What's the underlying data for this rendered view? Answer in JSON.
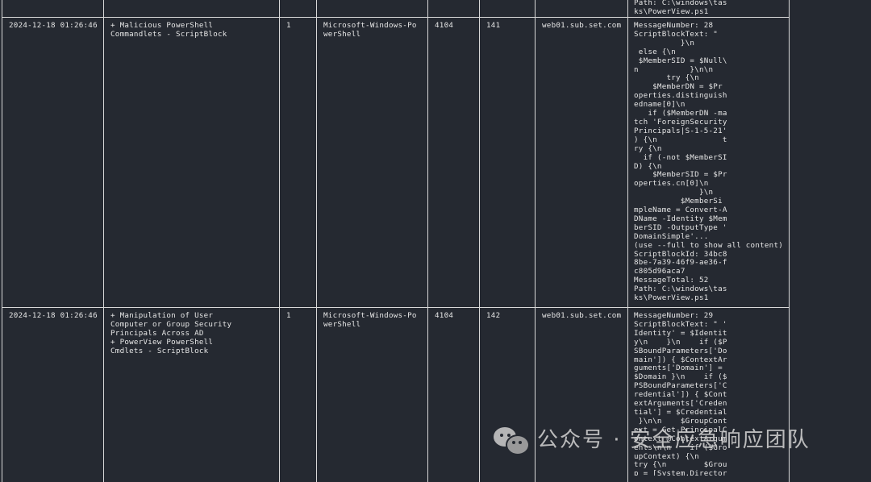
{
  "rows": [
    {
      "time": "",
      "rule": "",
      "level": "",
      "channel": "",
      "event_id": "",
      "record_id": "",
      "computer": "",
      "details": "Path: C:\\windows\\tas\nks\\PowerView.ps1"
    },
    {
      "time": "2024-12-18 01:26:46",
      "rule": "+ Malicious PowerShell\nCommandlets - ScriptBlock",
      "level": "1",
      "channel": "Microsoft-Windows-Po\nwerShell",
      "event_id": "4104",
      "record_id": "141",
      "computer": "web01.sub.set.com",
      "details": "MessageNumber: 28\nScriptBlockText: \"\n          }\\n\n else {\\n\n $MemberSID = $Null\\\nn           }\\n\\n\n       try {\\n\n    $MemberDN = $Pr\noperties.distinguish\nedname[0]\\n\n   if ($MemberDN -ma\ntch 'ForeignSecurity\nPrincipals|S-1-5-21'\n) {\\n              t\nry {\\n\n  if (-not $MemberSI\nD) {\\n\n    $MemberSID = $Pr\noperties.cn[0]\\n\n              }\\n\n          $MemberSi\nmpleName = Convert-A\nDName -Identity $Mem\nberSID -OutputType '\nDomainSimple'...\n(use --full to show all content)\nScriptBlockId: 34bc8\n8be-7a39-46f9-ae36-f\nc805d96aca7\nMessageTotal: 52\nPath: C:\\windows\\tas\nks\\PowerView.ps1"
    },
    {
      "time": "2024-12-18 01:26:46",
      "rule": "+ Manipulation of User\nComputer or Group Security\nPrincipals Across AD\n+ PowerView PowerShell\nCmdlets - ScriptBlock",
      "level": "1",
      "channel": "Microsoft-Windows-Po\nwerShell",
      "event_id": "4104",
      "record_id": "142",
      "computer": "web01.sub.set.com",
      "details": "MessageNumber: 29\nScriptBlockText: \" '\nIdentity' = $Identit\ny\\n    }\\n    if ($P\nSBoundParameters['Do\nmain']) { $ContextAr\nguments['Domain'] =\n$Domain }\\n    if ($\nPSBoundParameters['C\nredential']) { $Cont\nextArguments['Creden\ntial'] = $Credential\n }\\n\\n    $GroupCont\next = Get-PrincipalC\nontext @ContextArgum\nents\\n\\n    if ($Gro\nupContext) {\\n\ntry {\\n        $Grou\np = [System.Director"
    }
  ],
  "watermark": {
    "icon": "wechat-icon",
    "text": "公众号 · 安全应急响应团队"
  }
}
